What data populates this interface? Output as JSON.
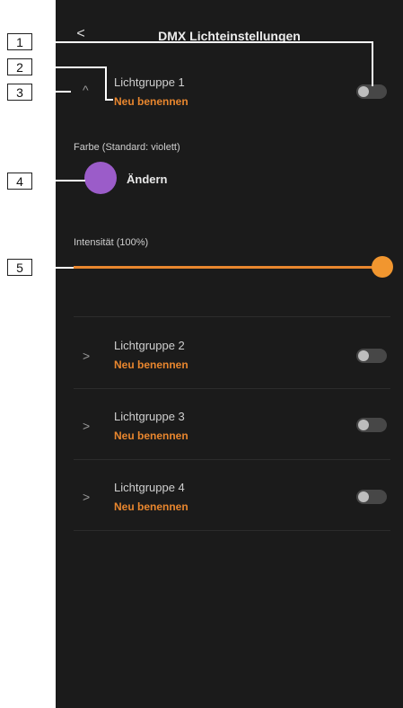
{
  "header": {
    "title": "DMX Lichteinstellungen",
    "back_icon": "chevron-left-icon"
  },
  "groups": [
    {
      "label": "Lichtgruppe 1",
      "rename": "Neu benennen",
      "expanded": true,
      "enabled": false
    },
    {
      "label": "Lichtgruppe 2",
      "rename": "Neu benennen",
      "expanded": false,
      "enabled": false
    },
    {
      "label": "Lichtgruppe 3",
      "rename": "Neu benennen",
      "expanded": false,
      "enabled": false
    },
    {
      "label": "Lichtgruppe 4",
      "rename": "Neu benennen",
      "expanded": false,
      "enabled": false
    }
  ],
  "color": {
    "label": "Farbe (Standard: violett)",
    "change_label": "Ändern",
    "swatch": "#9b5cc9"
  },
  "intensity": {
    "label": "Intensität (100%)",
    "value": 100
  },
  "callouts": [
    "1",
    "2",
    "3",
    "4",
    "5"
  ],
  "colors": {
    "background": "#1b1b1b",
    "accent": "#e8862e",
    "text": "#cfcfcf"
  }
}
